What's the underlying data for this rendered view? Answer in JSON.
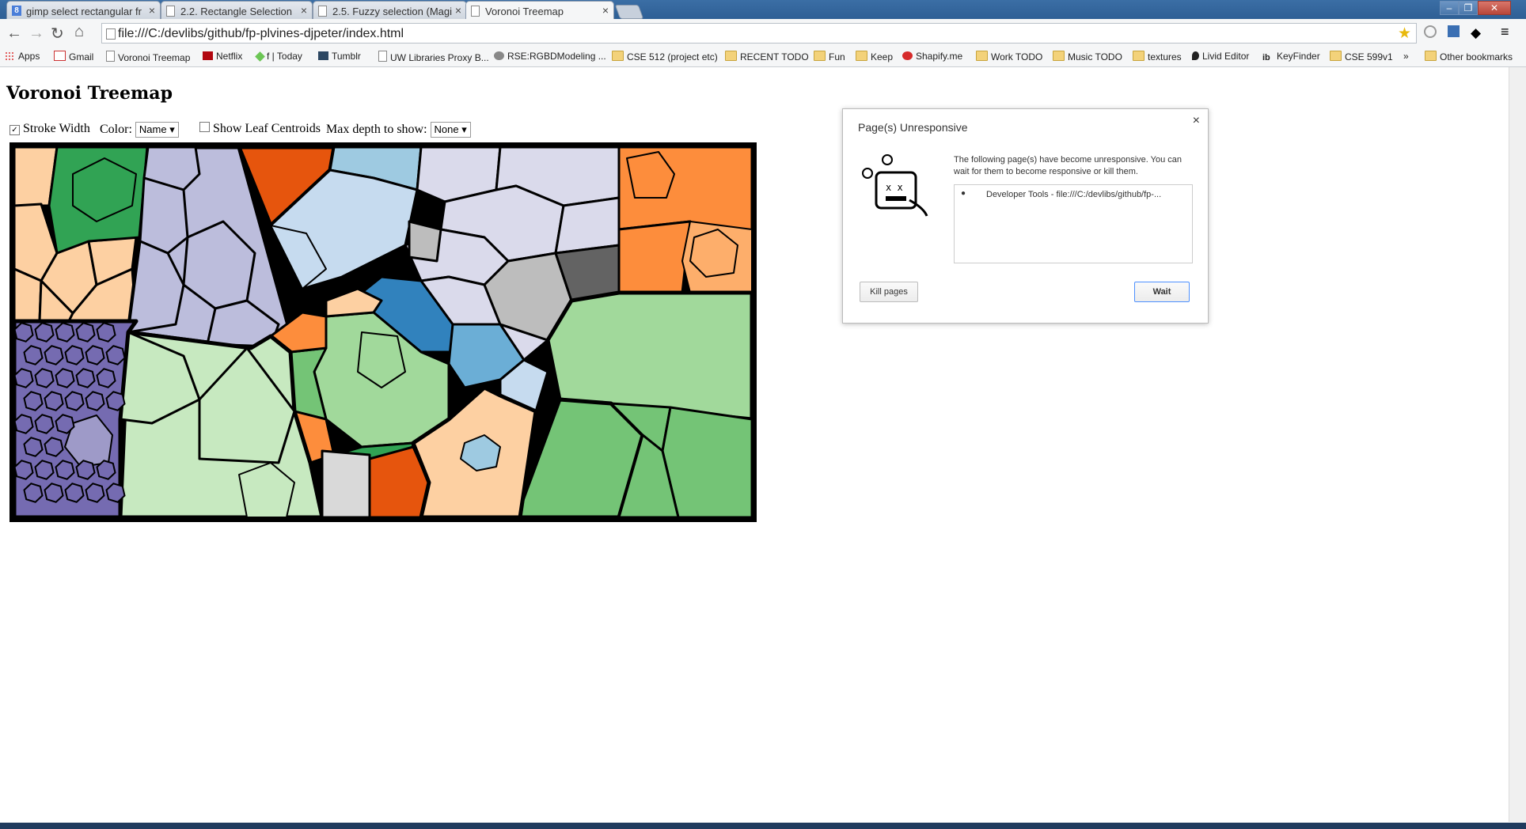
{
  "tabs": [
    {
      "title": "gimp select rectangular fr",
      "active": false
    },
    {
      "title": "2.2. Rectangle Selection",
      "active": false
    },
    {
      "title": "2.5. Fuzzy selection (Magi",
      "active": false
    },
    {
      "title": "Voronoi Treemap",
      "active": true
    }
  ],
  "address_bar": {
    "url": "file:///C:/devlibs/github/fp-plvines-djpeter/index.html"
  },
  "bookmarks": [
    {
      "label": "Apps",
      "icon": "apps-grid-icon"
    },
    {
      "label": "Gmail",
      "icon": "gmail-icon"
    },
    {
      "label": "Voronoi Treemap",
      "icon": "page-icon"
    },
    {
      "label": "Netflix",
      "icon": "netflix-icon"
    },
    {
      "label": "f | Today",
      "icon": "feedly-icon"
    },
    {
      "label": "Tumblr",
      "icon": "tumblr-icon"
    },
    {
      "label": "UW Libraries Proxy B...",
      "icon": "page-icon"
    },
    {
      "label": "RSE:RGBDModeling ...",
      "icon": "site-icon"
    },
    {
      "label": "CSE 512 (project etc)",
      "icon": "folder-icon"
    },
    {
      "label": "RECENT TODO",
      "icon": "folder-icon"
    },
    {
      "label": "Fun",
      "icon": "folder-icon"
    },
    {
      "label": "Keep",
      "icon": "folder-icon"
    },
    {
      "label": "Shapify.me",
      "icon": "shapify-icon"
    },
    {
      "label": "Work TODO",
      "icon": "folder-icon"
    },
    {
      "label": "Music TODO",
      "icon": "folder-icon"
    },
    {
      "label": "textures",
      "icon": "folder-icon"
    },
    {
      "label": "Livid Editor",
      "icon": "livid-icon"
    },
    {
      "label": "KeyFinder",
      "icon": "keyfinder-icon"
    },
    {
      "label": "CSE 599v1",
      "icon": "folder-icon"
    },
    {
      "label": "»",
      "icon": "overflow-chevron"
    },
    {
      "label": "Other bookmarks",
      "icon": "folder-icon"
    }
  ],
  "page": {
    "title": "Voronoi Treemap",
    "controls": {
      "stroke_width_label": "Stroke Width",
      "stroke_width_checked": true,
      "color_label": "Color:",
      "color_value": "Name",
      "show_centroids_label": "Show Leaf Centroids",
      "show_centroids_checked": false,
      "max_depth_label": "Max depth to show:",
      "max_depth_value": "None"
    }
  },
  "dialog": {
    "title": "Page(s) Unresponsive",
    "message": "The following page(s) have become unresponsive. You can wait for them to become responsive or kill them.",
    "list_item": "Developer Tools - file:///C:/devlibs/github/fp-...",
    "kill_label": "Kill pages",
    "wait_label": "Wait"
  },
  "colors": {
    "peach": "#fdd0a2",
    "green": "#31a354",
    "lavender": "#bcbddc",
    "orange_dark": "#e6550d",
    "sky": "#9ecae1",
    "pale_lavender": "#dadaeb",
    "orange": "#fd8d3c",
    "light_orange": "#fdae6b",
    "pale_blue": "#c6dbef",
    "blue": "#3182bd",
    "mid_blue": "#6baed6",
    "gray": "#bdbdbd",
    "dark_gray": "#636363",
    "purple": "#756bb1",
    "light_purple": "#9e9ac8",
    "pale_green": "#c7e9c0",
    "light_green": "#a1d99b",
    "mid_green": "#74c476",
    "light_gray": "#d9d9d9"
  }
}
